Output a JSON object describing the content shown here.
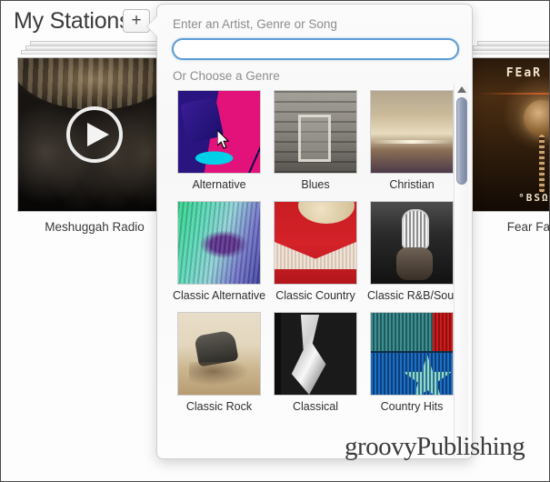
{
  "app": {
    "page_title": "My Stations",
    "add_button_label": "+"
  },
  "stations": [
    {
      "name": "Meshuggah Radio",
      "art": "meshuggah-band-photo",
      "play_icon": "play-icon"
    },
    {
      "name": "Fear Factory",
      "art": "fear-factory-obsolete-cover",
      "art_title": "FEaR Fac",
      "art_subtitle": "°BSΩLE"
    }
  ],
  "popover": {
    "search_label": "Enter an Artist, Genre or Song",
    "search_value": "",
    "search_placeholder": "",
    "genre_label": "Or Choose a Genre",
    "scrollbar": {
      "up_arrow_icon": "triangle-up-icon",
      "thumb_color": "#8e99b2"
    },
    "genres": [
      {
        "label": "Alternative",
        "art": "alternative-art"
      },
      {
        "label": "Blues",
        "art": "blues-art"
      },
      {
        "label": "Christian",
        "art": "christian-art"
      },
      {
        "label": "Classic Alternative",
        "art": "classic-alternative-art"
      },
      {
        "label": "Classic Country",
        "art": "classic-country-art"
      },
      {
        "label": "Classic R&B/Soul",
        "art": "classic-rb-soul-art"
      },
      {
        "label": "Classic Rock",
        "art": "classic-rock-art"
      },
      {
        "label": "Classical",
        "art": "classical-art"
      },
      {
        "label": "Country Hits",
        "art": "country-hits-art"
      }
    ]
  },
  "watermark": {
    "text": "groovyPublishing"
  },
  "colors": {
    "accent_blue": "#5d9cd4",
    "label_gray": "#8d8d8d",
    "text_dark": "#3a3a3a"
  }
}
